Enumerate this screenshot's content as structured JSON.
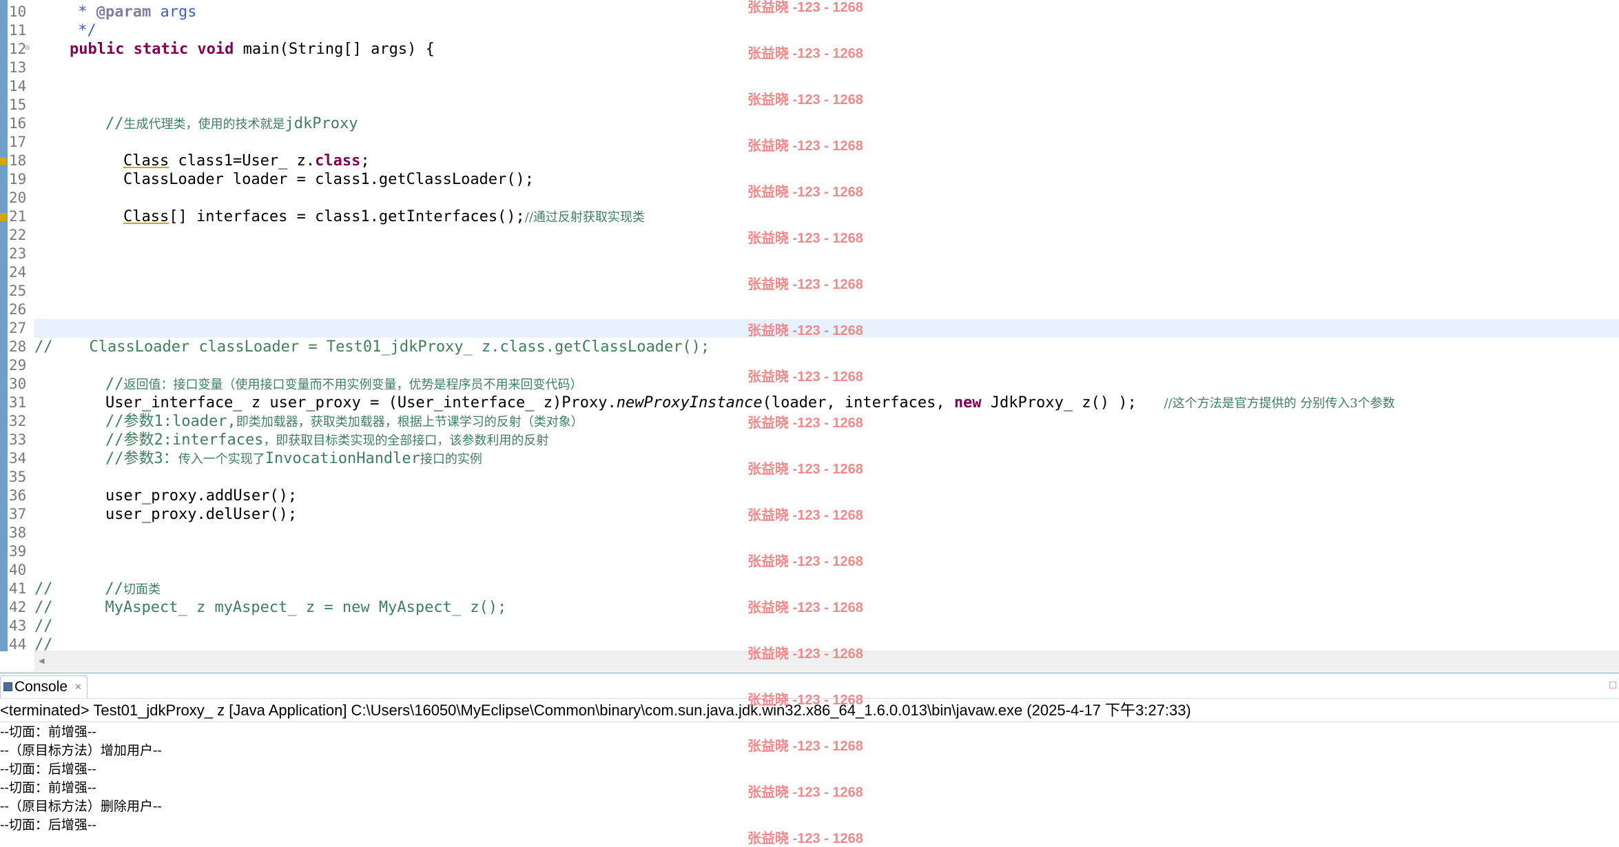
{
  "editor": {
    "line_numbers": [
      "10",
      "11",
      "12",
      "13",
      "14",
      "15",
      "16",
      "17",
      "18",
      "19",
      "20",
      "21",
      "22",
      "23",
      "24",
      "25",
      "26",
      "27",
      "28",
      "29",
      "30",
      "31",
      "32",
      "33",
      "34",
      "35",
      "36",
      "37",
      "38",
      "39",
      "40",
      "41",
      "42",
      "43",
      "44"
    ],
    "code": {
      "l10_a": " * ",
      "l10_b": "@param",
      "l10_c": " args",
      "l11": " */",
      "l12_kw": "public static void",
      "l12_rest": " main(String[] args) {",
      "l16_a": "//",
      "l16_b": "生成代理类，使用的技术就是",
      "l16_c": "jdkProxy",
      "l18_a": "Class",
      "l18_b": " class1=User_ z.",
      "l18_c": "class",
      "l18_d": ";",
      "l19": "ClassLoader loader = class1.getClassLoader();",
      "l21_a": "Class",
      "l21_b": "[] interfaces = class1.getInterfaces();",
      "l21_c": "//通过反射获取实现类",
      "l28_a": "//",
      "l28_b": "ClassLoader classLoader = Test01_jdkProxy_ z.class.getClassLoader();",
      "l30_a": "//",
      "l30_b": "返回值：接口变量（使用接口变量而不用实例变量，优势是程序员不用来回变代码）",
      "l31_a": "User_interface_ z user_proxy = (User_interface_ z)Proxy.",
      "l31_b": "newProxyInstance",
      "l31_c": "(loader, interfaces, ",
      "l31_d": "new",
      "l31_e": " JdkProxy_ z() );   ",
      "l31_f": "//这个方法是官方提供的 分别传入3个参数",
      "l32_a": "//参数1:loader,",
      "l32_b": "即类加载器，获取类加载器，根据上节课学习的反射（类对象）",
      "l33_a": "//参数2:interfaces",
      "l33_b": "，即获取目标类实现的全部接口，该参数利用的反射",
      "l34_a": "//参数3：",
      "l34_b": "传入一个实现了",
      "l34_c": "InvocationHandler",
      "l34_d": "接口的实例",
      "l36": "user_proxy.addUser();",
      "l37": "user_proxy.delUser();",
      "l41_a": "//",
      "l41_b": "//",
      "l41_c": "切面类",
      "l42_a": "//",
      "l42_b": "MyAspect_ z myAspect_ z = new MyAspect_ z();",
      "l43": "//",
      "l44": "//"
    }
  },
  "console": {
    "tab_label": "Console",
    "close_symbol": "✕",
    "status": "<terminated> Test01_jdkProxy_ z [Java Application] C:\\Users\\16050\\MyEclipse\\Common\\binary\\com.sun.java.jdk.win32.x86_64_1.6.0.013\\bin\\javaw.exe (2025-4-17 下午3:27:33)",
    "output": [
      "--切面：前增强--",
      "--（原目标方法）增加用户--",
      "--切面：后增强--",
      "--切面：前增强--",
      "--（原目标方法）删除用户--",
      "--切面：后增强--"
    ]
  },
  "watermark": {
    "text": "张益晓 -123 - 1268"
  },
  "colors": {
    "keyword": "#7f0055",
    "comment": "#3f7f5f",
    "javadoc": "#3f5fbf",
    "watermark": "#f08a8a",
    "current_line": "#e8f2fe"
  }
}
